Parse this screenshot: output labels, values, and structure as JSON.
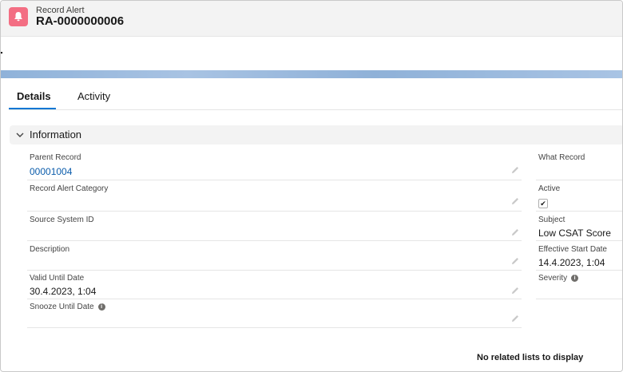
{
  "header": {
    "object_label": "Record Alert",
    "record_name": "RA-0000000006",
    "icon": "bell-icon",
    "icon_bg": "#f36e83"
  },
  "tabs": [
    {
      "label": "Details",
      "active": true
    },
    {
      "label": "Activity",
      "active": false
    }
  ],
  "section": {
    "title": "Information",
    "expanded": true
  },
  "left_fields": [
    {
      "label": "Parent Record",
      "value": "00001004",
      "is_link": true,
      "editable": true
    },
    {
      "label": "Record Alert Category",
      "value": "",
      "editable": true
    },
    {
      "label": "Source System ID",
      "value": "",
      "editable": true
    },
    {
      "label": "Description",
      "value": "",
      "editable": true
    },
    {
      "label": "Valid Until Date",
      "value": "30.4.2023, 1:04",
      "editable": true
    },
    {
      "label": "Snooze Until Date",
      "value": "",
      "editable": true,
      "has_info": true
    }
  ],
  "right_fields": [
    {
      "label": "What Record",
      "value": ""
    },
    {
      "label": "Active",
      "checked": true
    },
    {
      "label": "Subject",
      "value": "Low CSAT Score"
    },
    {
      "label": "Effective Start Date",
      "value": "14.4.2023, 1:04"
    },
    {
      "label": "Severity",
      "value": "",
      "has_info": true
    }
  ],
  "footer": {
    "no_related": "No related lists to display"
  },
  "colors": {
    "accent": "#0176d3",
    "link": "#0b5cab"
  }
}
